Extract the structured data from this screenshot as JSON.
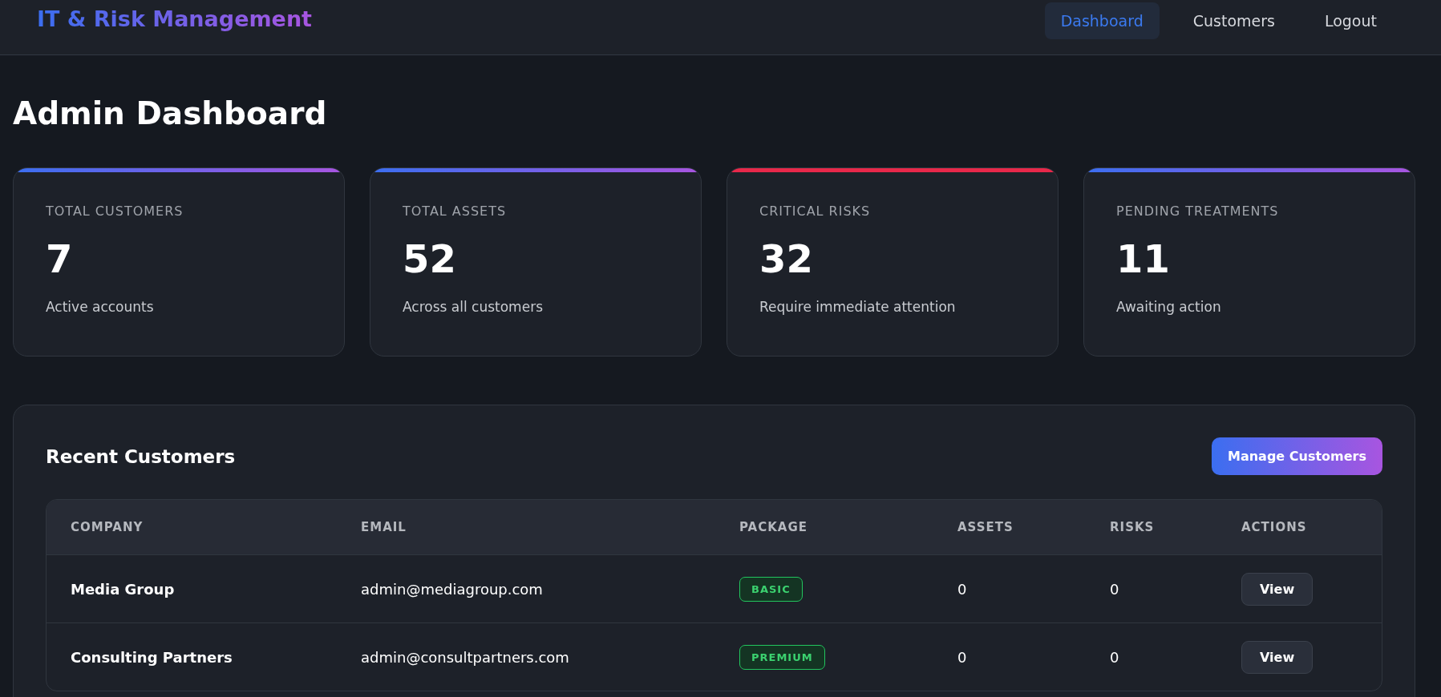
{
  "header": {
    "logo": "IT & Risk Management",
    "nav": [
      {
        "label": "Dashboard",
        "selected": true
      },
      {
        "label": "Customers",
        "selected": false
      },
      {
        "label": "Logout",
        "selected": false
      }
    ]
  },
  "page_title": "Admin Dashboard",
  "stats": [
    {
      "label": "TOTAL CUSTOMERS",
      "value": "7",
      "caption": "Active accounts",
      "kind": "gradient"
    },
    {
      "label": "TOTAL ASSETS",
      "value": "52",
      "caption": "Across all customers",
      "kind": "gradient"
    },
    {
      "label": "CRITICAL RISKS",
      "value": "32",
      "caption": "Require immediate attention",
      "kind": "danger"
    },
    {
      "label": "PENDING TREATMENTS",
      "value": "11",
      "caption": "Awaiting action",
      "kind": "gradient"
    }
  ],
  "recent_customers": {
    "title": "Recent Customers",
    "button": "Manage Customers",
    "columns": [
      "COMPANY",
      "EMAIL",
      "PACKAGE",
      "ASSETS",
      "RISKS",
      "ACTIONS"
    ],
    "rows": [
      {
        "company": "Media Group",
        "email": "admin@mediagroup.com",
        "package": "BASIC",
        "assets": "0",
        "risks": "0",
        "action": "View"
      },
      {
        "company": "Consulting Partners",
        "email": "admin@consultpartners.com",
        "package": "PREMIUM",
        "assets": "0",
        "risks": "0",
        "action": "View"
      }
    ]
  }
}
